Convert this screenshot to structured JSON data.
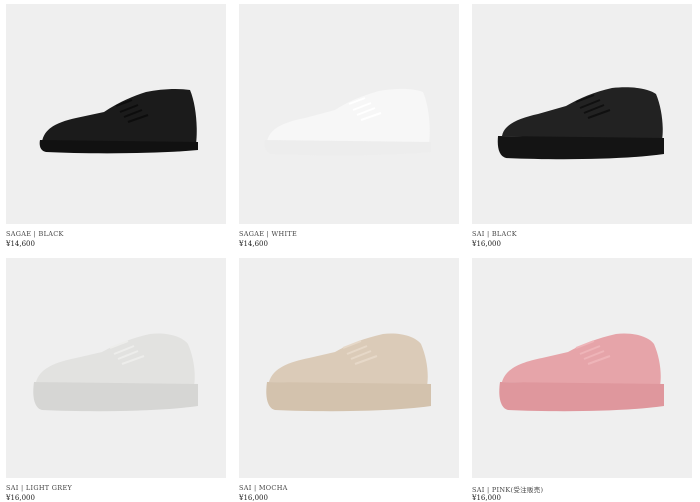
{
  "products": [
    {
      "name": "SAGAE | BLACK",
      "price": "¥14,600",
      "color": "#1b1b1b",
      "sole": "#111111",
      "lace": "#0d0d0d"
    },
    {
      "name": "SAGAE | WHITE",
      "price": "¥14,600",
      "color": "#f7f7f7",
      "sole": "#ededed",
      "lace": "#ffffff"
    },
    {
      "name": "SAI | BLACK",
      "price": "¥16,000",
      "color": "#222222",
      "sole": "#141414",
      "lace": "#101010"
    },
    {
      "name": "SAI | LIGHT GREY",
      "price": "¥16,000",
      "color": "#e2e2e0",
      "sole": "#d6d6d4",
      "lace": "#ededeb"
    },
    {
      "name": "SAI | MOCHA",
      "price": "¥16,000",
      "color": "#dbcbb8",
      "sole": "#d3c2ad",
      "lace": "#e6d8c8"
    },
    {
      "name": "SAI | PINK(受注販売)",
      "price": "¥16,000",
      "color": "#e6a4a9",
      "sole": "#df979d",
      "lace": "#eeb4b8"
    }
  ]
}
